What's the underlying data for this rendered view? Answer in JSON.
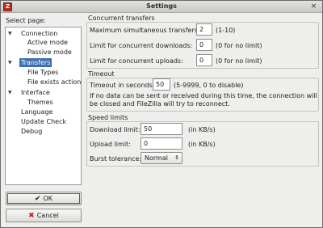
{
  "window": {
    "title": "Settings",
    "app_icon": "filezilla-icon",
    "close_glyph": "×"
  },
  "sidebar": {
    "label": "Select page:",
    "items": [
      {
        "label": "Connection",
        "expanded": true
      },
      {
        "label": "Active mode"
      },
      {
        "label": "Passive mode"
      },
      {
        "label": "Transfers",
        "expanded": true,
        "selected": true
      },
      {
        "label": "File Types"
      },
      {
        "label": "File exists action"
      },
      {
        "label": "Interface",
        "expanded": true
      },
      {
        "label": "Themes"
      },
      {
        "label": "Language"
      },
      {
        "label": "Update Check"
      },
      {
        "label": "Debug"
      }
    ],
    "ok_label": "OK",
    "cancel_label": "Cancel"
  },
  "concurrent": {
    "title": "Concurrent transfers",
    "max_label": "Maximum simultaneous transfers:",
    "max_value": "2",
    "max_hint": "(1-10)",
    "downloads_label": "Limit for concurrent downloads:",
    "downloads_value": "0",
    "downloads_hint": "(0 for no limit)",
    "uploads_label": "Limit for concurrent uploads:",
    "uploads_value": "0",
    "uploads_hint": "(0 for no limit)"
  },
  "timeout": {
    "title": "Timeout",
    "label": "Timeout in seconds:",
    "value": "50",
    "hint": "(5-9999, 0 to disable)",
    "info": "If no data can be sent or received during this time, the connection will be closed and FileZilla will try to reconnect."
  },
  "speed": {
    "title": "Speed limits",
    "download_label": "Download limit:",
    "download_value": "50",
    "download_unit": "(in KB/s)",
    "upload_label": "Upload limit:",
    "upload_value": "0",
    "upload_unit": "(in KB/s)",
    "burst_label": "Burst tolerance:",
    "burst_value": "Normal"
  }
}
